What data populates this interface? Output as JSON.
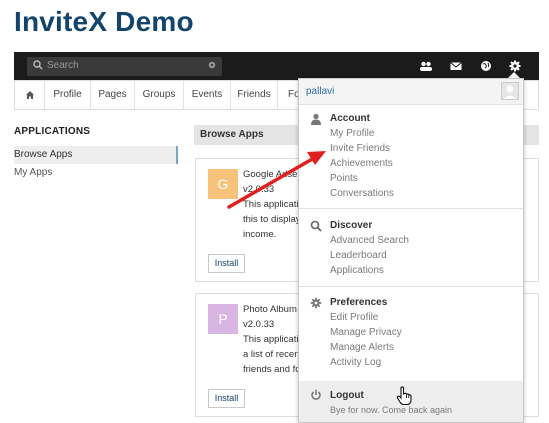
{
  "page": {
    "title": "InviteX Demo"
  },
  "topbar": {
    "search_placeholder": "Search",
    "icons": [
      "friends-icon",
      "mail-icon",
      "globe-icon",
      "gear-icon"
    ]
  },
  "nav": {
    "items": [
      "Profile",
      "Pages",
      "Groups",
      "Events",
      "Friends",
      "Fo"
    ]
  },
  "left": {
    "heading": "APPLICATIONS",
    "items": [
      "Browse Apps",
      "My Apps"
    ]
  },
  "main": {
    "heading": "Browse Apps",
    "cards": [
      {
        "initial": "G",
        "color": "#f7c27a",
        "lines": [
          "Google Adse",
          "v2.0.33",
          "This applicati",
          "this to display",
          "income."
        ],
        "install": "Install"
      },
      {
        "initial": "P",
        "color": "#d9b5e3",
        "lines": [
          "Photo Album",
          "v2.0.33",
          "This applicati",
          "a list of recen",
          "friends and fo"
        ],
        "install": "Install"
      }
    ]
  },
  "dropdown": {
    "username": "pallavi",
    "account": {
      "title": "Account",
      "links": [
        "My Profile",
        "Invite Friends",
        "Achievements",
        "Points",
        "Conversations"
      ]
    },
    "discover": {
      "title": "Discover",
      "links": [
        "Advanced Search",
        "Leaderboard",
        "Applications"
      ]
    },
    "preferences": {
      "title": "Preferences",
      "links": [
        "Edit Profile",
        "Manage Privacy",
        "Manage Alerts",
        "Activity Log"
      ]
    },
    "logout": {
      "title": "Logout",
      "subtitle": "Bye for now. Come back again"
    }
  },
  "colors": {
    "title": "#13456c",
    "topbar": "#1b1b1b",
    "annotation_arrow": "#e02020",
    "link_blue": "#2a6fb0"
  }
}
